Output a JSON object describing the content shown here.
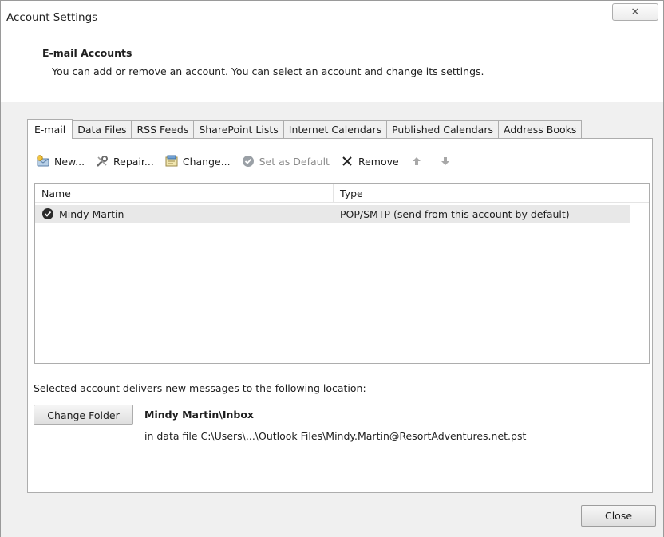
{
  "window": {
    "title": "Account Settings",
    "close_glyph": "✕"
  },
  "header": {
    "title": "E-mail Accounts",
    "description": "You can add or remove an account. You can select an account and change its settings."
  },
  "tabs": [
    {
      "label": "E-mail",
      "active": true
    },
    {
      "label": "Data Files"
    },
    {
      "label": "RSS Feeds"
    },
    {
      "label": "SharePoint Lists"
    },
    {
      "label": "Internet Calendars"
    },
    {
      "label": "Published Calendars"
    },
    {
      "label": "Address Books"
    }
  ],
  "toolbar": {
    "new_label": "New...",
    "repair_label": "Repair...",
    "change_label": "Change...",
    "set_default_label": "Set as Default",
    "remove_label": "Remove"
  },
  "accounts_list": {
    "columns": {
      "name": "Name",
      "type": "Type"
    },
    "rows": [
      {
        "name": "Mindy Martin",
        "type": "POP/SMTP (send from this account by default)"
      }
    ]
  },
  "delivery": {
    "label": "Selected account delivers new messages to the following location:",
    "change_folder_label": "Change Folder",
    "folder_name": "Mindy Martin\\Inbox",
    "folder_path": "in data file C:\\Users\\...\\Outlook Files\\Mindy.Martin@ResortAdventures.net.pst"
  },
  "footer": {
    "close_label": "Close"
  },
  "colors": {
    "accent_blue": "#2a6fb8",
    "panel_bg": "#f0f0f0",
    "selected_row": "#e8e8e8"
  }
}
